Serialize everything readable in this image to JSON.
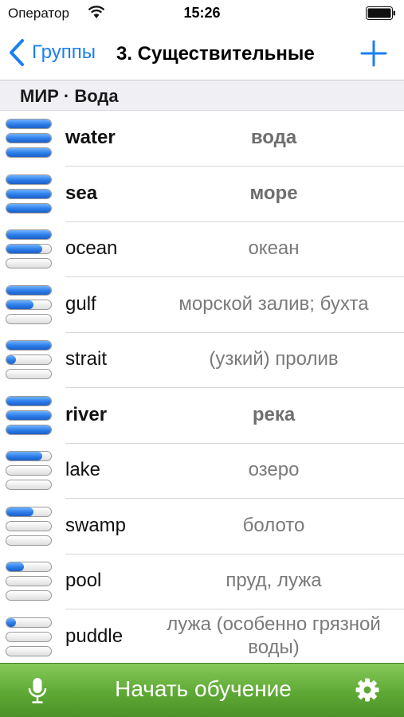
{
  "status_bar": {
    "carrier": "Оператор",
    "time": "15:26"
  },
  "nav": {
    "back_label": "Группы",
    "title": "3. Существительные"
  },
  "section": {
    "title": "МИР · Вода"
  },
  "words": [
    {
      "term": "water",
      "translation": "вода",
      "known": true,
      "progress": [
        1.0,
        1.0,
        1.0
      ]
    },
    {
      "term": "sea",
      "translation": "море",
      "known": true,
      "progress": [
        1.0,
        1.0,
        1.0
      ]
    },
    {
      "term": "ocean",
      "translation": "океан",
      "known": false,
      "progress": [
        1.0,
        0.8,
        0.0
      ]
    },
    {
      "term": "gulf",
      "translation": "морской залив; бухта",
      "known": false,
      "progress": [
        1.0,
        0.6,
        0.0
      ]
    },
    {
      "term": "strait",
      "translation": "(узкий) пролив",
      "known": false,
      "progress": [
        1.0,
        0.15,
        0.0
      ]
    },
    {
      "term": "river",
      "translation": "река",
      "known": true,
      "progress": [
        1.0,
        1.0,
        1.0
      ]
    },
    {
      "term": "lake",
      "translation": "озеро",
      "known": false,
      "progress": [
        0.8,
        0.0,
        0.0
      ]
    },
    {
      "term": "swamp",
      "translation": "болото",
      "known": false,
      "progress": [
        0.6,
        0.0,
        0.0
      ]
    },
    {
      "term": "pool",
      "translation": "пруд, лужа",
      "known": false,
      "progress": [
        0.4,
        0.0,
        0.0
      ]
    },
    {
      "term": "puddle",
      "translation": "лужа (особенно грязной воды)",
      "known": false,
      "progress": [
        0.2,
        0.0,
        0.0
      ]
    }
  ],
  "bottom_bar": {
    "start_label": "Начать обучение"
  },
  "colors": {
    "accent": "#1b7ff5",
    "progress_fill": "#2b7de9",
    "bottom_bar": "#5ea935"
  },
  "icons": {
    "wifi": "wifi-icon",
    "battery": "battery-icon",
    "back": "chevron-left-icon",
    "add": "plus-icon",
    "mic": "microphone-icon",
    "settings": "gear-icon"
  }
}
